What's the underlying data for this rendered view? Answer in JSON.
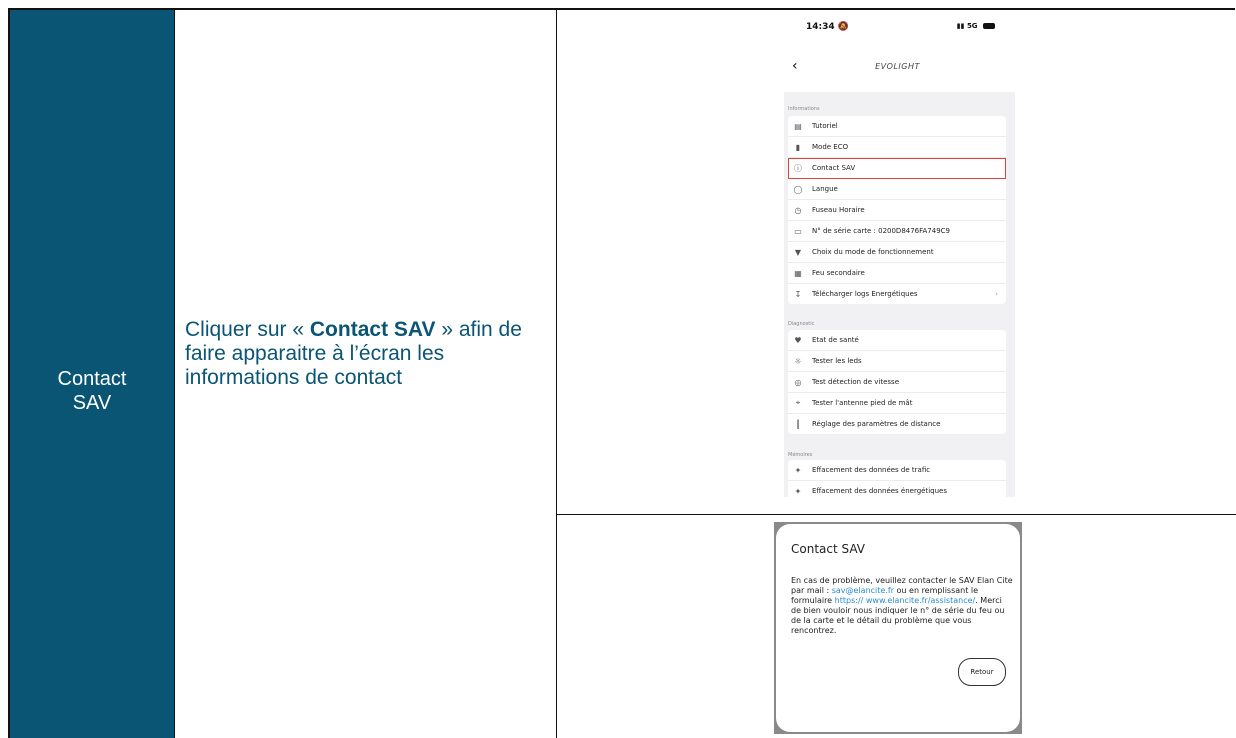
{
  "row_label": "Contact SAV",
  "instruction": {
    "before": "Cliquer sur « ",
    "bold": "Contact SAV",
    "after": " » afin de faire apparaitre à l’écran les informations de contact"
  },
  "phone": {
    "time": "14:34",
    "network": "5G",
    "title": "EVOLIGHT",
    "sections": [
      {
        "heading": "Informations",
        "items": [
          {
            "label": "Tutoriel",
            "icon": "book-icon"
          },
          {
            "label": "Mode ECO",
            "icon": "battery-icon"
          },
          {
            "label": "Contact SAV",
            "icon": "help-icon",
            "highlighted": true
          },
          {
            "label": "Langue",
            "icon": "globe-icon"
          },
          {
            "label": "Fuseau Horaire",
            "icon": "clock-icon"
          },
          {
            "label": "N° de série carte : 0200D8476FA749C9",
            "icon": "laptop-icon"
          },
          {
            "label": "Choix du mode de fonctionnement",
            "icon": "plug-icon"
          },
          {
            "label": "Feu secondaire",
            "icon": "traffic-light-icon"
          },
          {
            "label": "Télécharger logs Energétiques",
            "icon": "download-icon",
            "chevron": true
          }
        ]
      },
      {
        "heading": "Diagnostic",
        "items": [
          {
            "label": "Etat de santé",
            "icon": "heart-icon"
          },
          {
            "label": "Tester les leds",
            "icon": "sun-icon"
          },
          {
            "label": "Test détection de vitesse",
            "icon": "speed-icon"
          },
          {
            "label": "Tester l'antenne pied de mât",
            "icon": "antenna-icon"
          },
          {
            "label": "Réglage des paramètres de distance",
            "icon": "pole-icon"
          }
        ]
      },
      {
        "heading": "Mémoires",
        "items": [
          {
            "label": "Effacement des données de trafic",
            "icon": "broom-icon"
          },
          {
            "label": "Effacement des données énergétiques",
            "icon": "broom-energy-icon"
          }
        ]
      }
    ]
  },
  "dialog": {
    "title": "Contact SAV",
    "text_1": "En cas de problème, veuillez contacter le SAV Elan Cite par mail : ",
    "email": "sav@elancite.fr",
    "text_2": " ou en remplissant le formulaire ",
    "url": "https:// www.elancite.fr/assistance/",
    "text_3": ". Merci de bien vouloir nous indiquer le n° de série du feu ou de la carte et le détail du problème que vous rencontrez.",
    "button": "Retour"
  }
}
